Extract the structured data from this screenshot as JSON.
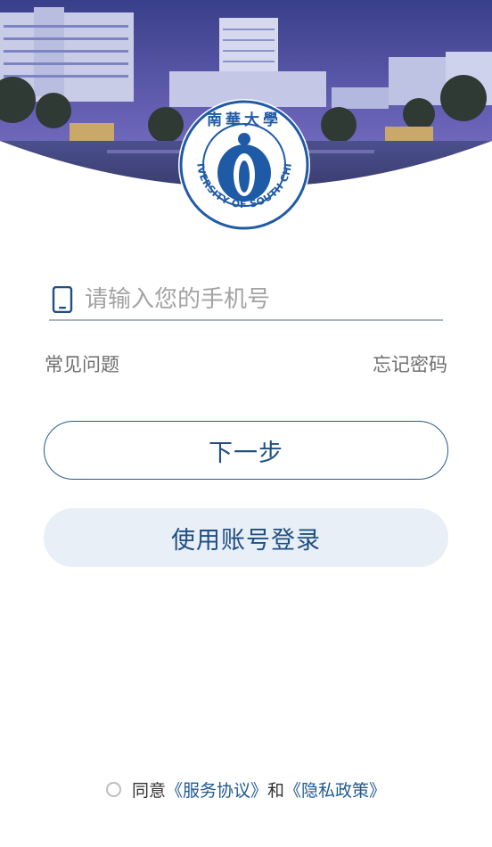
{
  "header": {
    "logo_seal_text": "UNIVERSITY OF SOUTH CHINA",
    "logo_calligraphy": "南華大學"
  },
  "login": {
    "phone_placeholder": "请输入您的手机号",
    "phone_value": "",
    "faq_label": "常见问题",
    "forgot_password_label": "忘记密码",
    "next_button_label": "下一步",
    "account_login_label": "使用账号登录"
  },
  "agreement": {
    "agree_text": "同意",
    "service_agreement": "《服务协议》",
    "and_text": "和",
    "privacy_policy": "《隐私政策》",
    "checked": false
  },
  "colors": {
    "accent": "#1f4f85",
    "secondary_button_bg": "#e8eff6",
    "seal_blue": "#1f5aa6"
  }
}
